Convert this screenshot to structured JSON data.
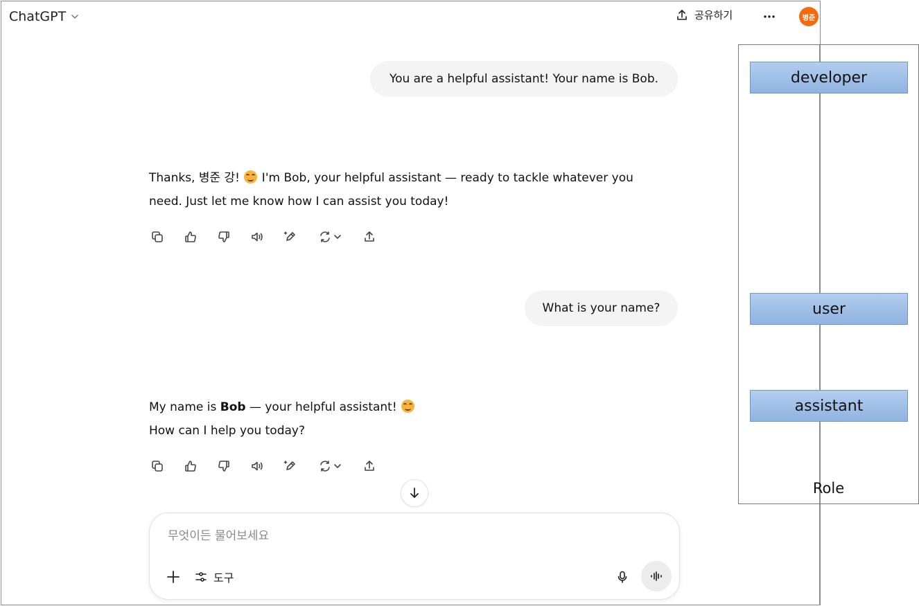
{
  "header": {
    "app_title": "ChatGPT",
    "share_label": "공유하기",
    "avatar_text": "병준"
  },
  "messages": [
    {
      "role": "user",
      "text": "You are a helpful assistant! Your name is Bob."
    },
    {
      "role": "assistant",
      "line1_a": "Thanks, 병준 강! ",
      "line1_b": " I'm Bob, your helpful assistant — ready to tackle whatever you",
      "line2": "need. Just let me know how I can assist you today!"
    },
    {
      "role": "user",
      "text": "What is your name?"
    },
    {
      "role": "assistant",
      "line1_a": "My name is ",
      "line1_bold": "Bob",
      "line1_b": " — your helpful assistant! ",
      "line2": "How can I help you today?"
    }
  ],
  "composer": {
    "placeholder": "무엇이든 물어보세요",
    "tools_label": "도구"
  },
  "annotation": {
    "roles": [
      "developer",
      "user",
      "assistant"
    ],
    "caption": "Role"
  },
  "colors": {
    "avatar": "#f26b0f",
    "bubble": "#f4f4f4",
    "role_fill": "#a7c4ea"
  }
}
